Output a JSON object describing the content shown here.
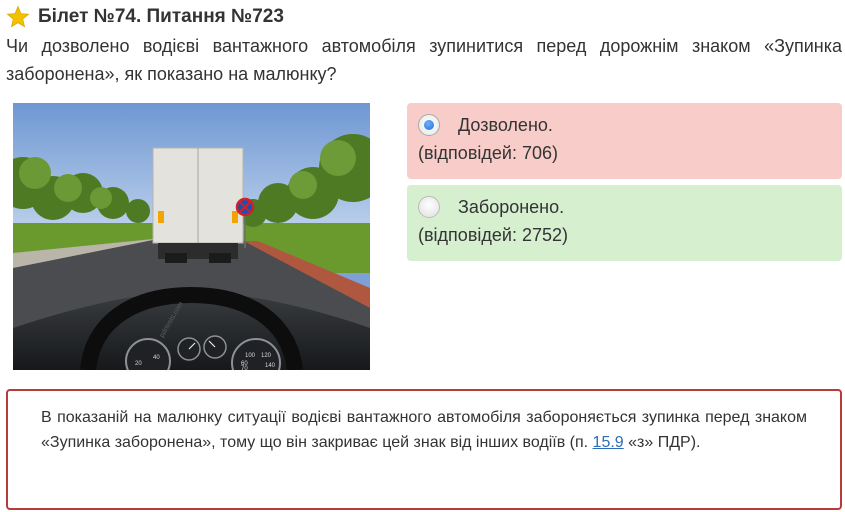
{
  "header": {
    "title": "Білет №74. Питання №723",
    "star_color": "#f2c200"
  },
  "question": {
    "text": "Чи дозволено водієві вантажного автомобіля зупинитися перед дорожнім знаком «Зупинка заборонена», як показано на малюнку?"
  },
  "image": {
    "watermark": "pdrtests.com",
    "speedometer_ticks": [
      "20",
      "40",
      "60",
      "70",
      "100",
      "120",
      "140"
    ]
  },
  "answers": [
    {
      "label": "Дозволено.",
      "count_text": "(відповідей: 706)",
      "selected": true,
      "color": "#f8cdc9"
    },
    {
      "label": "Заборонено.",
      "count_text": "(відповідей: 2752)",
      "selected": false,
      "color": "#d5efcf"
    }
  ],
  "explanation": {
    "text_before": "В показаній на малюнку ситуації водієві вантажного автомобіля забороняється зупинка перед знаком «Зупинка заборонена», тому що він закриває цей знак від інших водіїв (п. ",
    "link_text": "15.9",
    "text_after": " «з» ПДР).",
    "border_color": "#b83b3b",
    "link_color": "#2e6db3"
  }
}
